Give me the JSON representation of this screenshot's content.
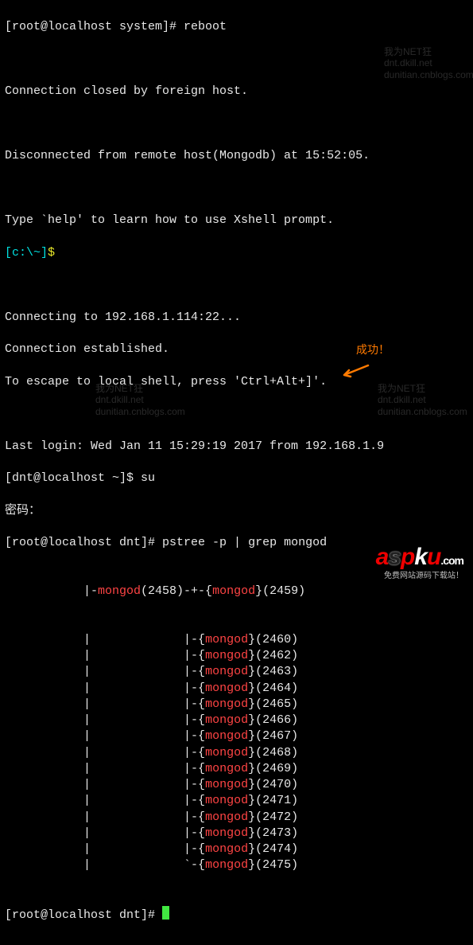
{
  "lines": {
    "top_cut": "",
    "prompt1_user": "[root@localhost system]# ",
    "cmd_reboot": "reboot",
    "closed": "Connection closed by foreign host.",
    "disconnected": "Disconnected from remote host(Mongodb) at 15:52:05.",
    "help": "Type `help' to learn how to use Xshell prompt.",
    "cprompt_open": "[c:\\~]",
    "cprompt_dollar": "$",
    "connecting": "Connecting to 192.168.1.114:22...",
    "established": "Connection established.",
    "escape": "To escape to local shell, press 'Ctrl+Alt+]'.",
    "lastlogin": "Last login: Wed Jan 11 15:29:19 2017 from 192.168.1.9",
    "prompt_dnt": "[dnt@localhost ~]$ ",
    "cmd_su": "su",
    "passwd": "密码：",
    "prompt_root": "[root@localhost dnt]# ",
    "cmd_pstree": "pstree -p | grep mongod",
    "prompt_root2": "[root@localhost dnt]# "
  },
  "pstree": {
    "root_pre": "           |-",
    "root_proc": "mongod",
    "root_pid": "(2458)-+-{",
    "root_proc2": "mongod",
    "root_after": "}(2459)",
    "children": [
      {
        "pid": "2460"
      },
      {
        "pid": "2462"
      },
      {
        "pid": "2463"
      },
      {
        "pid": "2464"
      },
      {
        "pid": "2465"
      },
      {
        "pid": "2466"
      },
      {
        "pid": "2467"
      },
      {
        "pid": "2468"
      },
      {
        "pid": "2469"
      },
      {
        "pid": "2470"
      },
      {
        "pid": "2471"
      },
      {
        "pid": "2472"
      },
      {
        "pid": "2473"
      },
      {
        "pid": "2474"
      }
    ],
    "last": {
      "pid": "2475"
    },
    "proc_name": "mongod",
    "mid_branch": "|-{",
    "end_branch": "`-{",
    "pipe": "           |"
  },
  "annotation": "成功！",
  "watermark_l1": "我为NET狂",
  "watermark_l2": "dnt.dkill.net",
  "watermark_l3": "dunitian.cnblogs.com",
  "logo": {
    "word": "aspku",
    "dot": ".",
    "com": "com",
    "sub": "免费网站源码下载站！"
  }
}
